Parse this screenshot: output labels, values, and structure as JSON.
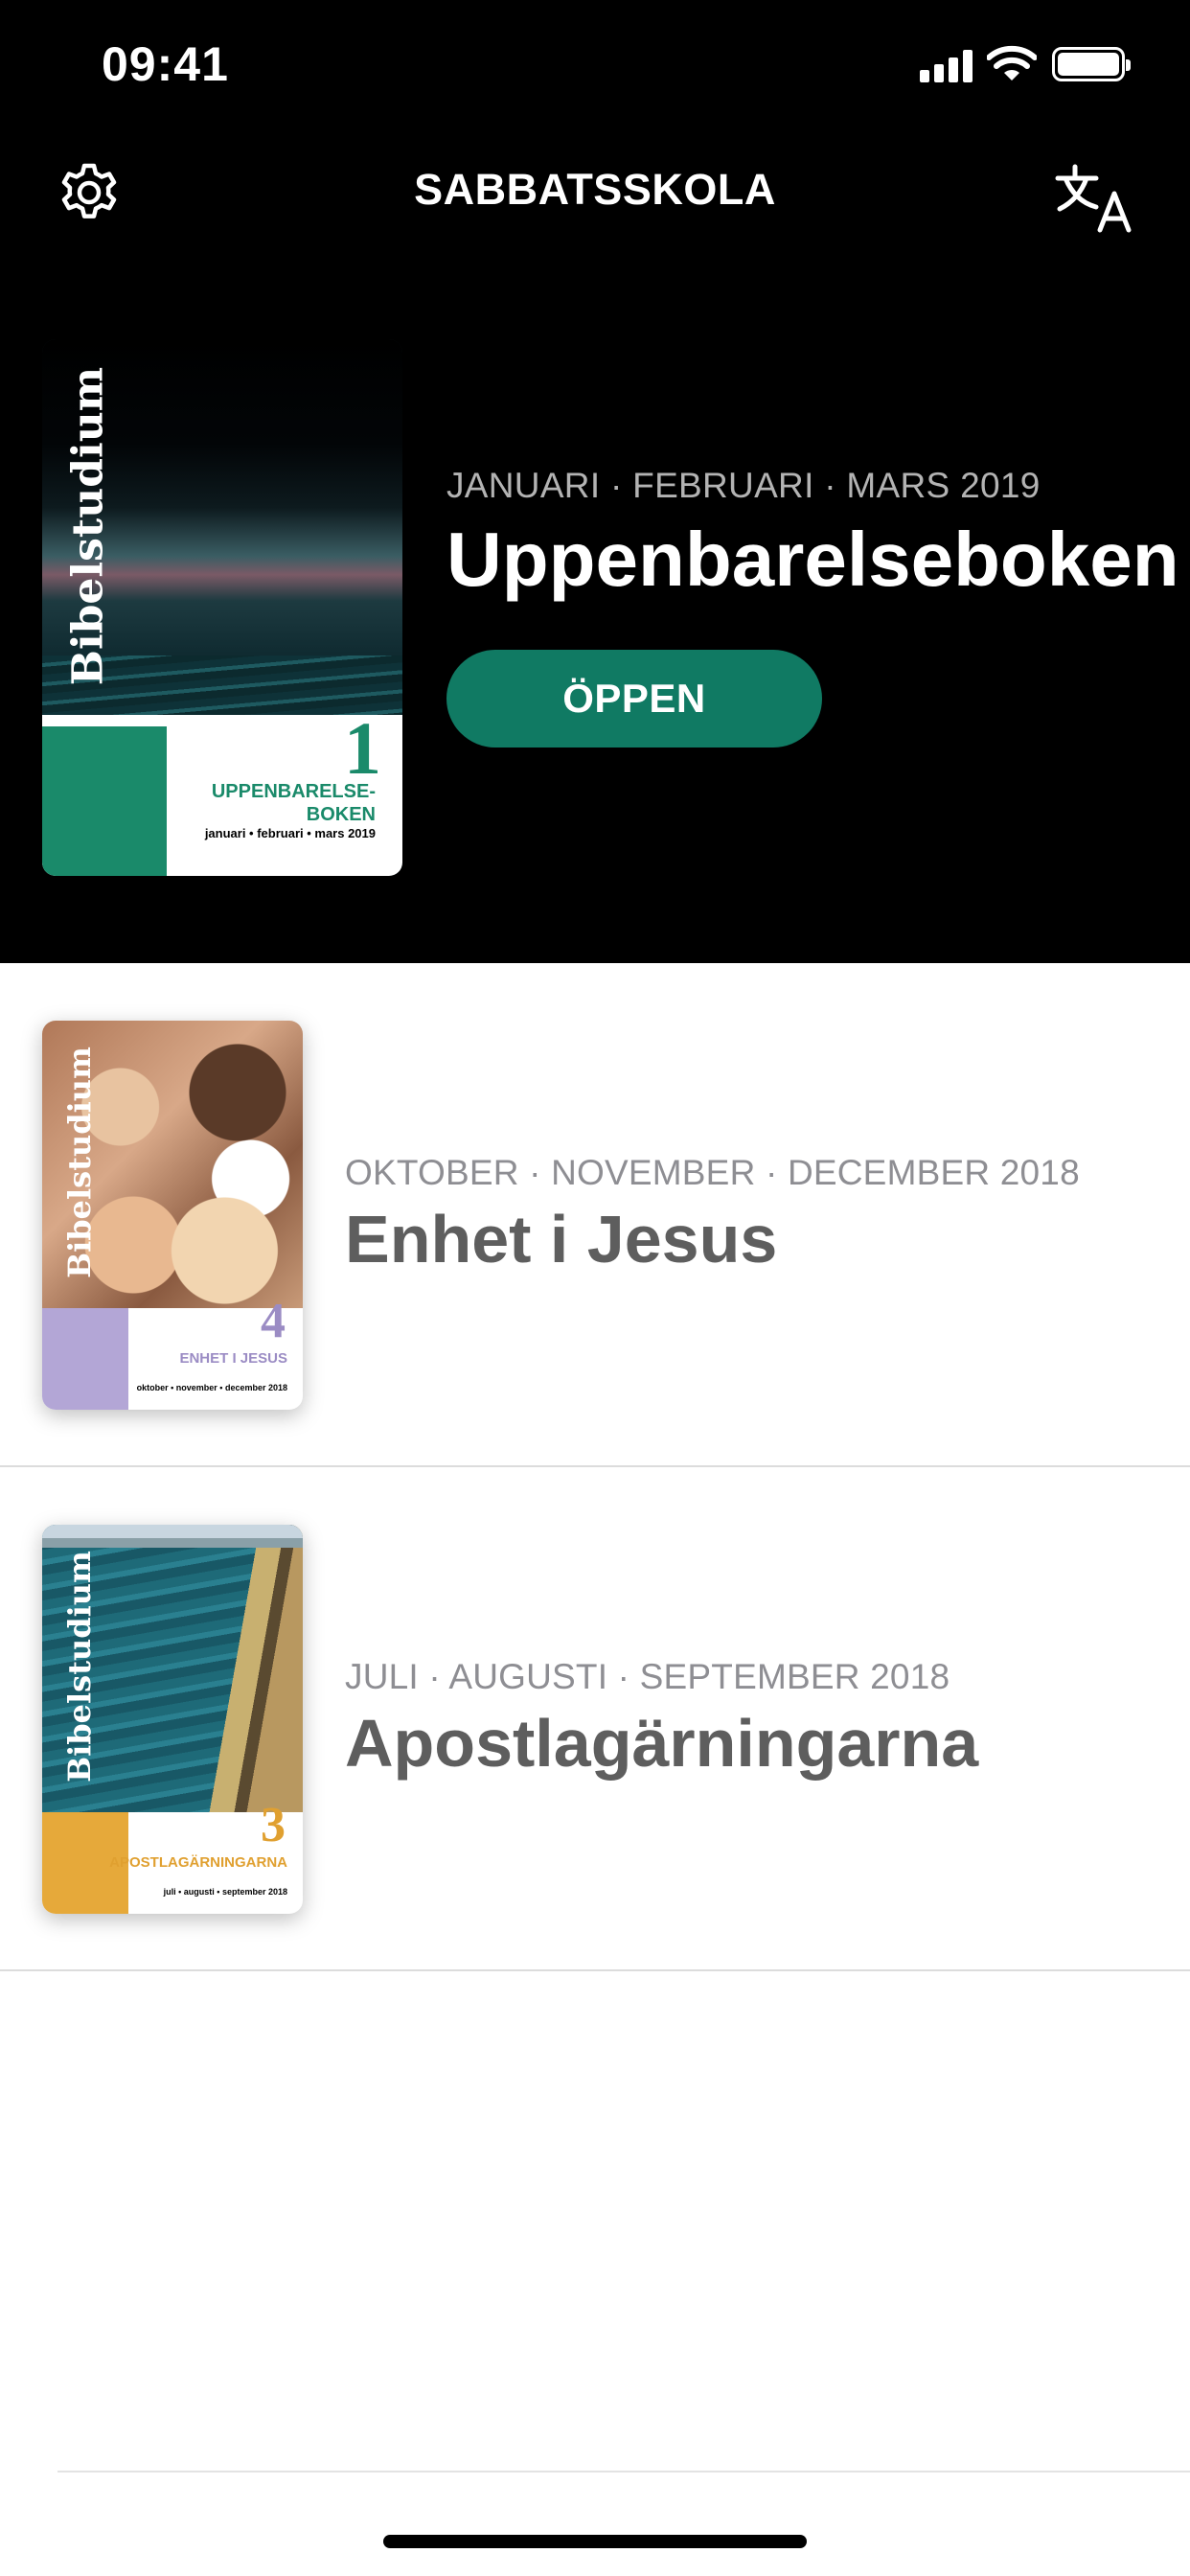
{
  "status_bar": {
    "time": "09:41",
    "icons": [
      "signal-icon",
      "wifi-icon",
      "battery-icon"
    ]
  },
  "header": {
    "title": "SABBATSSKOLA",
    "left_icon": "gear-icon",
    "right_icon": "translate-icon"
  },
  "featured": {
    "date": "JANUARI · FEBRUARI · MARS 2019",
    "title": "Uppenbarelseboken",
    "button_label": "ÖPPEN",
    "cover": {
      "spine": "Bibelstudium",
      "number": "1",
      "name_line1": "UPPENBARELSE-",
      "name_line2": "BOKEN",
      "dates": "januari • februari • mars 2019",
      "color": "#1a8a6a"
    }
  },
  "quarterlies": [
    {
      "date": "OKTOBER · NOVEMBER · DECEMBER 2018",
      "title": "Enhet i Jesus",
      "cover": {
        "spine": "Bibelstudium",
        "number": "4",
        "name": "ENHET I JESUS",
        "dates": "oktober • november • december 2018",
        "color": "#9b8cc4"
      }
    },
    {
      "date": "JULI · AUGUSTI · SEPTEMBER 2018",
      "title": "Apostlagärningarna",
      "cover": {
        "spine": "Bibelstudium",
        "number": "3",
        "name": "APOSTLAGÄRNINGARNA",
        "dates": "juli • augusti • september 2018",
        "color": "#e0a030"
      }
    }
  ],
  "colors": {
    "accent": "#107a63",
    "header_bg": "#000000"
  }
}
